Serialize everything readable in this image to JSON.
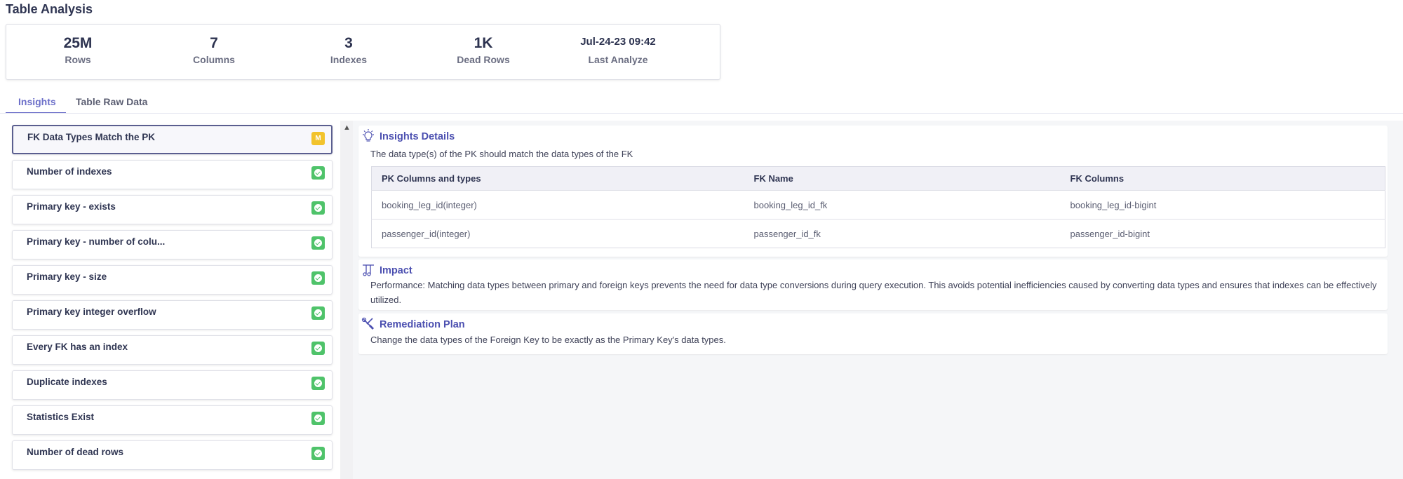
{
  "page_title": "Table Analysis",
  "stats": [
    {
      "value": "25M",
      "label": "Rows"
    },
    {
      "value": "7",
      "label": "Columns"
    },
    {
      "value": "3",
      "label": "Indexes"
    },
    {
      "value": "1K",
      "label": "Dead Rows"
    },
    {
      "value": "Jul-24-23 09:42",
      "label": "Last Analyze"
    }
  ],
  "tabs": [
    {
      "label": "Insights",
      "active": true
    },
    {
      "label": "Table Raw Data",
      "active": false
    }
  ],
  "insights": [
    {
      "label": "FK Data Types Match the PK",
      "badge": "M",
      "badge_color": "#f2c32c",
      "selected": true
    },
    {
      "label": "Number of indexes",
      "badge": "ok"
    },
    {
      "label": "Primary key - exists",
      "badge": "ok"
    },
    {
      "label": "Primary key - number of colu...",
      "badge": "ok"
    },
    {
      "label": "Primary key - size",
      "badge": "ok"
    },
    {
      "label": "Primary key integer overflow",
      "badge": "ok"
    },
    {
      "label": "Every FK has an index",
      "badge": "ok"
    },
    {
      "label": "Duplicate indexes",
      "badge": "ok"
    },
    {
      "label": "Statistics Exist",
      "badge": "ok"
    },
    {
      "label": "Number of dead rows",
      "badge": "ok"
    }
  ],
  "details": {
    "title": "Insights Details",
    "icon": "lightbulb-icon",
    "description": "The data type(s) of the PK should match the data types of the FK",
    "table": {
      "headers": [
        "PK Columns and types",
        "FK Name",
        "FK Columns"
      ],
      "rows": [
        [
          "booking_leg_id(integer)",
          "booking_leg_id_fk",
          "booking_leg_id-bigint"
        ],
        [
          "passenger_id(integer)",
          "passenger_id_fk",
          "passenger_id-bigint"
        ]
      ]
    }
  },
  "impact": {
    "title": "Impact",
    "icon": "impact-icon",
    "text": "Performance: Matching data types between primary and foreign keys prevents the need for data type conversions during query execution. This avoids potential inefficiencies caused by converting data types and ensures that indexes can be effectively utilized."
  },
  "remediation": {
    "title": "Remediation Plan",
    "icon": "tools-icon",
    "text": "Change the data types of the Foreign Key to be exactly as the Primary Key's data types."
  },
  "colors": {
    "accent": "#6c6fc9",
    "section_title": "#4b4fb0",
    "badge_ok": "#4fc36a",
    "badge_medium": "#f2c32c"
  }
}
